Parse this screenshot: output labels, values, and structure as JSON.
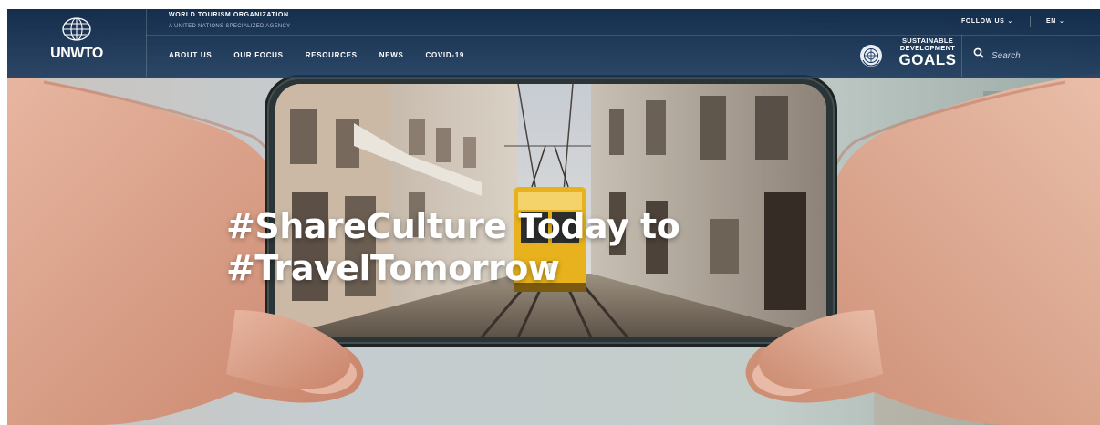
{
  "header": {
    "logo_text": "UNWTO",
    "org_name": "WORLD TOURISM ORGANIZATION",
    "org_subtitle": "A UNITED NATIONS SPECIALIZED AGENCY",
    "follow_label": "FOLLOW US",
    "lang_label": "EN",
    "nav": [
      {
        "label": "ABOUT US"
      },
      {
        "label": "OUR FOCUS"
      },
      {
        "label": "RESOURCES"
      },
      {
        "label": "NEWS"
      },
      {
        "label": "COVID-19"
      }
    ],
    "sdg": {
      "line1": "SUSTAINABLE",
      "line2": "DEVELOPMENT",
      "line3": "GOALS"
    },
    "search_placeholder": "Search"
  },
  "hero": {
    "headline_line1": "#ShareCulture Today to",
    "headline_line2": "#TravelTomorrow"
  },
  "colors": {
    "header_bg": "#153158",
    "tram_yellow": "#e7b21d",
    "text_white": "#ffffff"
  },
  "icons": [
    "globe-icon",
    "un-emblem-icon",
    "search-icon",
    "chevron-down-icon"
  ]
}
